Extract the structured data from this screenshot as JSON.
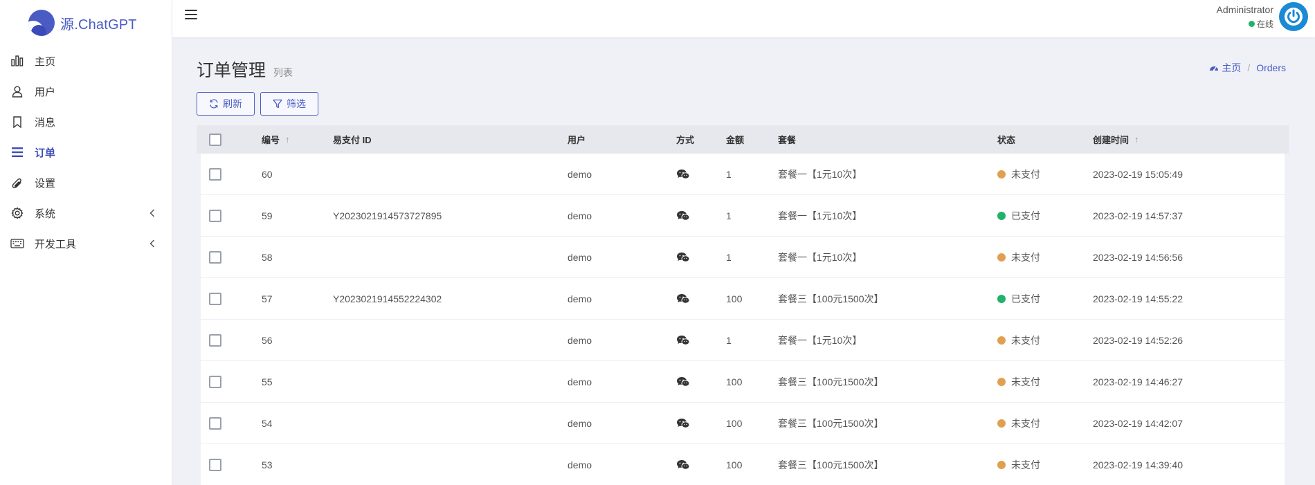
{
  "app": {
    "logo_text": "源.ChatGPT"
  },
  "sidebar": {
    "items": [
      {
        "label": "主页",
        "icon": "bar-chart-icon",
        "active": false
      },
      {
        "label": "用户",
        "icon": "user-icon",
        "active": false
      },
      {
        "label": "消息",
        "icon": "bookmark-icon",
        "active": false
      },
      {
        "label": "订单",
        "icon": "list-icon",
        "active": true
      },
      {
        "label": "设置",
        "icon": "paperclip-icon",
        "active": false
      },
      {
        "label": "系统",
        "icon": "gear-icon",
        "active": false,
        "has_children": true
      },
      {
        "label": "开发工具",
        "icon": "keyboard-icon",
        "active": false,
        "has_children": true
      }
    ]
  },
  "header": {
    "user_name": "Administrator",
    "user_status": "在线"
  },
  "page": {
    "title": "订单管理",
    "subtitle": "列表",
    "breadcrumb": {
      "home": "主页",
      "current": "Orders"
    }
  },
  "toolbar": {
    "refresh_label": "刷新",
    "filter_label": "筛选"
  },
  "table": {
    "columns": {
      "id": "编号",
      "pay_id": "易支付 ID",
      "user": "用户",
      "method": "方式",
      "amount": "金额",
      "package": "套餐",
      "status": "状态",
      "created": "创建时间"
    },
    "rows": [
      {
        "id": "60",
        "pay_id": "",
        "user": "demo",
        "amount": "1",
        "package": "套餐一【1元10次】",
        "status": "未支付",
        "status_color": "#e0a050",
        "created": "2023-02-19 15:05:49"
      },
      {
        "id": "59",
        "pay_id": "Y2023021914573727895",
        "user": "demo",
        "amount": "1",
        "package": "套餐一【1元10次】",
        "status": "已支付",
        "status_color": "#21b26b",
        "created": "2023-02-19 14:57:37"
      },
      {
        "id": "58",
        "pay_id": "",
        "user": "demo",
        "amount": "1",
        "package": "套餐一【1元10次】",
        "status": "未支付",
        "status_color": "#e0a050",
        "created": "2023-02-19 14:56:56"
      },
      {
        "id": "57",
        "pay_id": "Y2023021914552224302",
        "user": "demo",
        "amount": "100",
        "package": "套餐三【100元1500次】",
        "status": "已支付",
        "status_color": "#21b26b",
        "created": "2023-02-19 14:55:22"
      },
      {
        "id": "56",
        "pay_id": "",
        "user": "demo",
        "amount": "1",
        "package": "套餐一【1元10次】",
        "status": "未支付",
        "status_color": "#e0a050",
        "created": "2023-02-19 14:52:26"
      },
      {
        "id": "55",
        "pay_id": "",
        "user": "demo",
        "amount": "100",
        "package": "套餐三【100元1500次】",
        "status": "未支付",
        "status_color": "#e0a050",
        "created": "2023-02-19 14:46:27"
      },
      {
        "id": "54",
        "pay_id": "",
        "user": "demo",
        "amount": "100",
        "package": "套餐三【100元1500次】",
        "status": "未支付",
        "status_color": "#e0a050",
        "created": "2023-02-19 14:42:07"
      },
      {
        "id": "53",
        "pay_id": "",
        "user": "demo",
        "amount": "100",
        "package": "套餐三【100元1500次】",
        "status": "未支付",
        "status_color": "#e0a050",
        "created": "2023-02-19 14:39:40"
      }
    ]
  },
  "colors": {
    "accent": "#4a5cc4",
    "paid": "#21b26b",
    "unpaid": "#e0a050",
    "avatar": "#1a8ad4"
  }
}
